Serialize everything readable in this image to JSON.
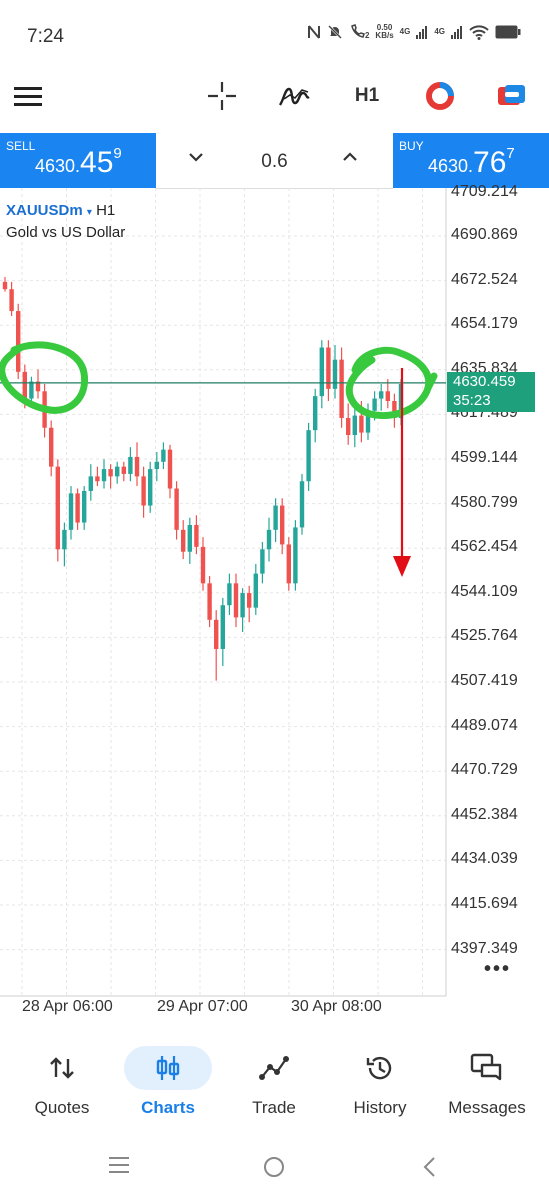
{
  "status_bar": {
    "time": "7:24",
    "net_speed_value": "0.50",
    "net_speed_unit": "KB/s",
    "sim1_label": "4G",
    "sim2_label": "4G",
    "sim_slot": "2"
  },
  "toolbar": {
    "menu_icon": "hamburger-menu-icon",
    "crosshair_icon": "crosshair-icon",
    "indicator_icon": "indicator-icon",
    "timeframe_label": "H1",
    "chart_color_icon": "account-ring-icon",
    "oneclick_icon": "one-click-trading-icon"
  },
  "trade_bar": {
    "sell_label": "SELL",
    "sell_price_main": "4630.",
    "sell_price_big": "45",
    "sell_price_sup": "9",
    "buy_label": "BUY",
    "buy_price_main": "4630.",
    "buy_price_big": "76",
    "buy_price_sup": "7",
    "lot_value": "0.6",
    "decrease_label": "⌄",
    "increase_label": "⌃"
  },
  "chart_header": {
    "symbol": "XAUUSDm",
    "caret": "▾",
    "timeframe": "H1",
    "description": "Gold vs US Dollar"
  },
  "price_axis": {
    "top_partial": "4709.214",
    "labels": [
      "4690.869",
      "4672.524",
      "4654.179",
      "4635.834",
      "4617.489",
      "4599.144",
      "4580.799",
      "4562.454",
      "4544.109",
      "4525.764",
      "4507.419",
      "4489.074",
      "4470.729",
      "4452.384",
      "4434.039",
      "4415.694",
      "4397.349"
    ],
    "current_price": "4630.459",
    "countdown": "35:23",
    "more": "•••"
  },
  "time_axis": [
    "28 Apr 06:00",
    "29 Apr 07:00",
    "30 Apr 08:00"
  ],
  "colors": {
    "bull": "#26a69a",
    "bear": "#ef5350",
    "accent": "#1a85f0",
    "annotation": "#39c93f",
    "arrow": "#e10e16",
    "current_line": "#1f7d63"
  },
  "chart_data": {
    "type": "candlestick",
    "symbol": "XAUUSDm",
    "timeframe": "H1",
    "ylim": [
      4393,
      4712
    ],
    "current_price": 4630.459,
    "candles": [
      [
        4672,
        4674,
        4668,
        4669
      ],
      [
        4669,
        4672,
        4658,
        4660
      ],
      [
        4660,
        4663,
        4632,
        4635
      ],
      [
        4635,
        4638,
        4620,
        4624
      ],
      [
        4624,
        4633,
        4621,
        4631
      ],
      [
        4631,
        4636,
        4624,
        4627
      ],
      [
        4627,
        4630,
        4608,
        4612
      ],
      [
        4612,
        4615,
        4592,
        4596
      ],
      [
        4596,
        4599,
        4557,
        4562
      ],
      [
        4562,
        4573,
        4555,
        4570
      ],
      [
        4570,
        4588,
        4566,
        4585
      ],
      [
        4585,
        4587,
        4570,
        4573
      ],
      [
        4573,
        4588,
        4570,
        4586
      ],
      [
        4586,
        4597,
        4582,
        4592
      ],
      [
        4592,
        4596,
        4588,
        4590
      ],
      [
        4590,
        4599,
        4587,
        4595
      ],
      [
        4595,
        4597,
        4587,
        4592
      ],
      [
        4592,
        4598,
        4589,
        4596
      ],
      [
        4596,
        4598,
        4590,
        4593
      ],
      [
        4593,
        4604,
        4590,
        4600
      ],
      [
        4600,
        4606,
        4588,
        4592
      ],
      [
        4592,
        4596,
        4575,
        4580
      ],
      [
        4580,
        4598,
        4577,
        4595
      ],
      [
        4595,
        4602,
        4590,
        4598
      ],
      [
        4598,
        4606,
        4595,
        4603
      ],
      [
        4603,
        4605,
        4583,
        4587
      ],
      [
        4587,
        4590,
        4566,
        4570
      ],
      [
        4570,
        4574,
        4558,
        4561
      ],
      [
        4561,
        4575,
        4556,
        4572
      ],
      [
        4572,
        4576,
        4560,
        4563
      ],
      [
        4563,
        4567,
        4545,
        4548
      ],
      [
        4548,
        4551,
        4530,
        4533
      ],
      [
        4533,
        4537,
        4508,
        4521
      ],
      [
        4521,
        4542,
        4514,
        4539
      ],
      [
        4539,
        4552,
        4535,
        4548
      ],
      [
        4548,
        4552,
        4530,
        4534
      ],
      [
        4534,
        4546,
        4528,
        4544
      ],
      [
        4544,
        4547,
        4532,
        4538
      ],
      [
        4538,
        4556,
        4535,
        4552
      ],
      [
        4552,
        4565,
        4548,
        4562
      ],
      [
        4562,
        4575,
        4557,
        4570
      ],
      [
        4570,
        4583,
        4565,
        4580
      ],
      [
        4580,
        4583,
        4560,
        4564
      ],
      [
        4564,
        4567,
        4545,
        4548
      ],
      [
        4548,
        4574,
        4545,
        4571
      ],
      [
        4571,
        4593,
        4568,
        4590
      ],
      [
        4590,
        4614,
        4586,
        4611
      ],
      [
        4611,
        4628,
        4606,
        4625
      ],
      [
        4625,
        4648,
        4620,
        4645
      ],
      [
        4645,
        4648,
        4623,
        4628
      ],
      [
        4628,
        4646,
        4624,
        4640
      ],
      [
        4640,
        4645,
        4612,
        4616
      ],
      [
        4616,
        4622,
        4605,
        4609
      ],
      [
        4609,
        4620,
        4604,
        4617
      ],
      [
        4617,
        4623,
        4606,
        4610
      ],
      [
        4610,
        4622,
        4607,
        4619
      ],
      [
        4619,
        4627,
        4615,
        4624
      ],
      [
        4624,
        4630,
        4619,
        4627
      ],
      [
        4627,
        4632,
        4620,
        4623
      ],
      [
        4623,
        4626,
        4612,
        4616
      ],
      [
        4616,
        4632,
        4613,
        4630
      ]
    ]
  },
  "bottom_nav": [
    {
      "label": "Quotes",
      "icon": "quotes-arrows-icon",
      "active": false
    },
    {
      "label": "Charts",
      "icon": "candlestick-icon",
      "active": true
    },
    {
      "label": "Trade",
      "icon": "trend-line-icon",
      "active": false
    },
    {
      "label": "History",
      "icon": "history-clock-icon",
      "active": false
    },
    {
      "label": "Messages",
      "icon": "messages-icon",
      "active": false
    }
  ],
  "system_nav": {
    "recents_icon": "recents-icon",
    "home_icon": "home-icon",
    "back_icon": "back-icon"
  }
}
